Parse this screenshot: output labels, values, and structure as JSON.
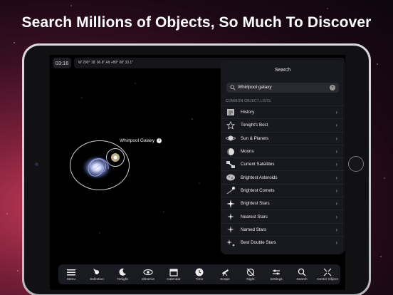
{
  "headline": "Search Millions of Objects, So Much To Discover",
  "topbar": {
    "time": "03:16",
    "coords": "W 290° 18' 06.8\" Alt +89° 08' 33.1\""
  },
  "sky": {
    "object_label": "Whirlpool Galaxy"
  },
  "search_panel": {
    "title": "Search",
    "query": "Whirlpool galaxy",
    "section_header": "COMMON OBJECT LISTS",
    "items": [
      {
        "label": "History",
        "icon": "history-icon"
      },
      {
        "label": "Tonight's Best",
        "icon": "star-outline-icon"
      },
      {
        "label": "Sun & Planets",
        "icon": "planet-icon"
      },
      {
        "label": "Moons",
        "icon": "moon-icon"
      },
      {
        "label": "Current Satellites",
        "icon": "satellite-icon"
      },
      {
        "label": "Brightest Asteroids",
        "icon": "asteroid-icon"
      },
      {
        "label": "Brightest Comets",
        "icon": "comet-icon"
      },
      {
        "label": "Brightest Stars",
        "icon": "bright-star-icon"
      },
      {
        "label": "Nearest Stars",
        "icon": "near-star-icon"
      },
      {
        "label": "Named Stars",
        "icon": "named-star-icon"
      },
      {
        "label": "Best Double Stars",
        "icon": "double-star-icon"
      }
    ]
  },
  "toolbar": {
    "items": [
      {
        "label": "Menu",
        "icon": "menu-icon"
      },
      {
        "label": "Selection",
        "icon": "selection-icon"
      },
      {
        "label": "Tonight",
        "icon": "tonight-icon"
      },
      {
        "label": "Observe",
        "icon": "eye-icon"
      },
      {
        "label": "Calendar",
        "icon": "calendar-icon"
      },
      {
        "label": "Time",
        "icon": "clock-icon"
      },
      {
        "label": "Scope",
        "icon": "telescope-icon"
      },
      {
        "label": "Night",
        "icon": "night-icon"
      },
      {
        "label": "Settings",
        "icon": "settings-icon"
      },
      {
        "label": "Search",
        "icon": "search-icon"
      },
      {
        "label": "Center Object",
        "icon": "center-icon"
      }
    ]
  },
  "colors": {
    "accent": "#ffffff",
    "panel": "#18181f"
  }
}
